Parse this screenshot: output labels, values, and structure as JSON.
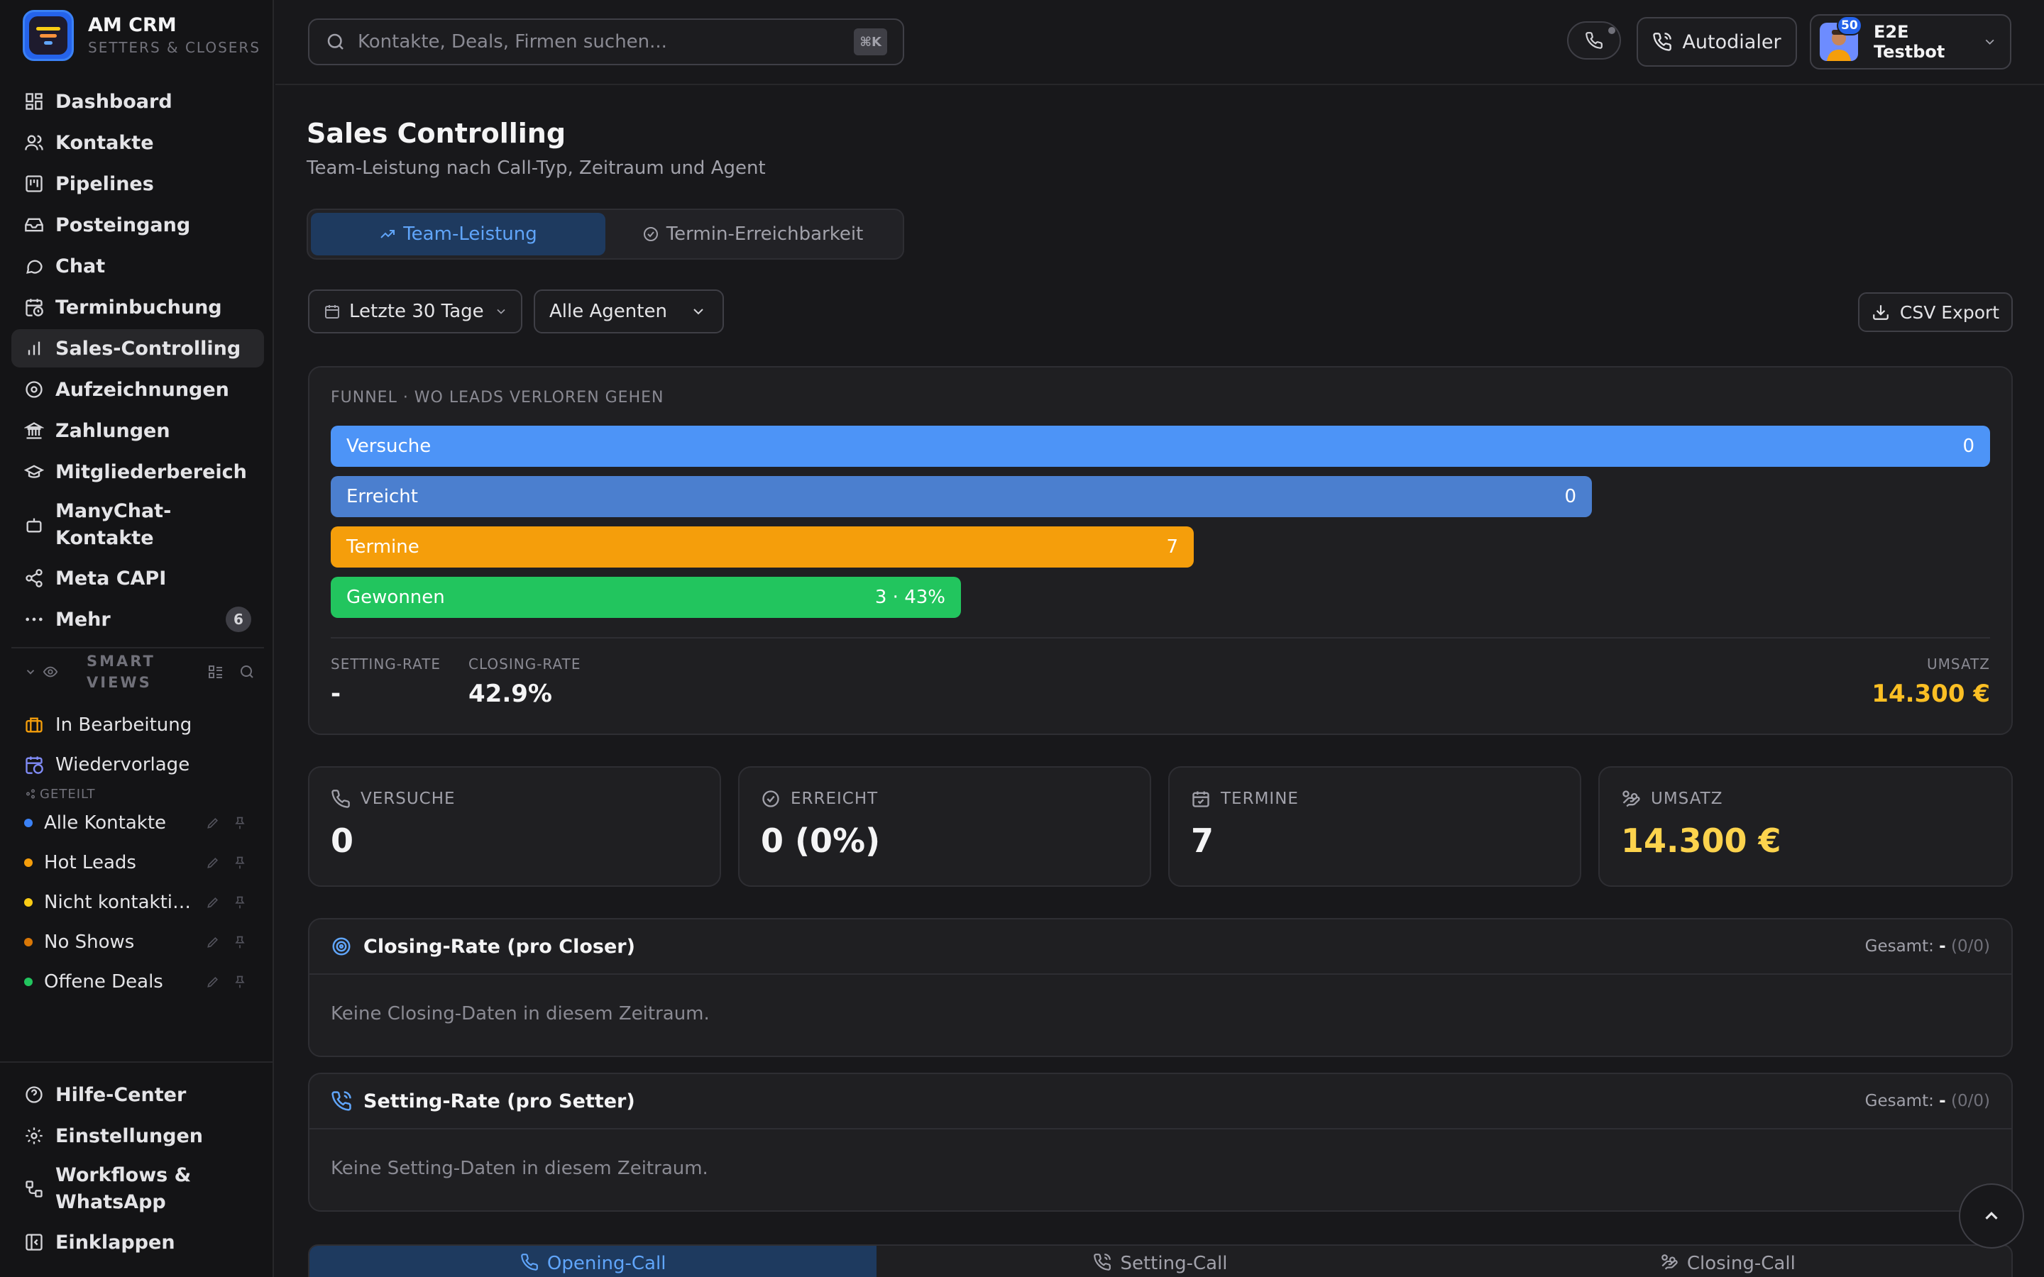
{
  "brand": {
    "title": "AM CRM",
    "subtitle": "SETTERS & CLOSERS"
  },
  "nav": [
    {
      "label": "Dashboard",
      "icon": "dashboard-icon"
    },
    {
      "label": "Kontakte",
      "icon": "users-icon"
    },
    {
      "label": "Pipelines",
      "icon": "kanban-icon"
    },
    {
      "label": "Posteingang",
      "icon": "inbox-icon"
    },
    {
      "label": "Chat",
      "icon": "chat-icon"
    },
    {
      "label": "Terminbuchung",
      "icon": "calendar-clock-icon"
    },
    {
      "label": "Sales-Controlling",
      "icon": "bar-chart-icon",
      "active": true
    },
    {
      "label": "Aufzeichnungen",
      "icon": "disc-icon"
    },
    {
      "label": "Zahlungen",
      "icon": "bank-icon"
    },
    {
      "label": "Mitgliederbereich",
      "icon": "graduation-cap-icon"
    },
    {
      "label": "ManyChat-Kontakte",
      "icon": "bot-icon"
    },
    {
      "label": "Meta CAPI",
      "icon": "share-icon"
    },
    {
      "label": "Mehr",
      "icon": "more-icon",
      "badge": "6"
    }
  ],
  "smart_views": {
    "title": "SMART VIEWS",
    "items": [
      {
        "label": "In Bearbeitung",
        "icon": "briefcase-icon",
        "color": "#f59e0b"
      },
      {
        "label": "Wiedervorlage",
        "icon": "calendar-clock-icon",
        "color": "#818cf8"
      }
    ],
    "shared_label": "GETEILT",
    "shared": [
      {
        "label": "Alle Kontakte",
        "color": "#3b82f6"
      },
      {
        "label": "Hot Leads",
        "color": "#f59e0b"
      },
      {
        "label": "Nicht kontaktiert",
        "color": "#facc15"
      },
      {
        "label": "No Shows",
        "color": "#d97706"
      },
      {
        "label": "Offene Deals",
        "color": "#22c55e"
      }
    ]
  },
  "bottom_nav": [
    {
      "label": "Hilfe-Center"
    },
    {
      "label": "Einstellungen"
    },
    {
      "label": "Workflows & WhatsApp"
    },
    {
      "label": "Einklappen"
    }
  ],
  "topbar": {
    "search_placeholder": "Kontakte, Deals, Firmen suchen...",
    "search_shortcut": "⌘K",
    "autodialer": "Autodialer",
    "user_name": "E2E Testbot",
    "user_level": "50"
  },
  "page": {
    "title": "Sales Controlling",
    "subtitle": "Team-Leistung nach Call-Typ, Zeitraum und Agent",
    "tabs": [
      "Team-Leistung",
      "Termin-Erreichbarkeit"
    ],
    "filter_period": "Letzte 30 Tage",
    "filter_agent": "Alle Agenten",
    "csv": "CSV Export"
  },
  "funnel": {
    "heading": "FUNNEL · WO LEADS VERLOREN GEHEN",
    "bars": [
      {
        "label": "Versuche",
        "value": "0",
        "fraction": 1.0,
        "color": "#4d94f7"
      },
      {
        "label": "Erreicht",
        "value": "0",
        "fraction": 0.76,
        "color": "#4b7fcf"
      },
      {
        "label": "Termine",
        "value": "7",
        "fraction": 0.52,
        "color": "#f59e0b"
      },
      {
        "label": "Gewonnen",
        "value": "3 · 43%",
        "fraction": 0.38,
        "color": "#22c55e"
      }
    ],
    "setting_rate_label": "SETTING-RATE",
    "setting_rate": "-",
    "closing_rate_label": "CLOSING-RATE",
    "closing_rate": "42.9%",
    "umsatz_label": "UMSATZ",
    "umsatz": "14.300 €"
  },
  "stats": [
    {
      "label": "VERSUCHE",
      "value": "0"
    },
    {
      "label": "ERREICHT",
      "value": "0 (0%)"
    },
    {
      "label": "TERMINE",
      "value": "7"
    },
    {
      "label": "UMSATZ",
      "value": "14.300 €"
    }
  ],
  "closing": {
    "title": "Closing-Rate (pro Closer)",
    "total_label": "Gesamt:",
    "total_value": "-",
    "total_count": "(0/0)",
    "empty": "Keine Closing-Daten in diesem Zeitraum."
  },
  "setting": {
    "title": "Setting-Rate (pro Setter)",
    "total_label": "Gesamt:",
    "total_value": "-",
    "total_count": "(0/0)",
    "empty": "Keine Setting-Daten in diesem Zeitraum."
  },
  "call_tabs": [
    "Opening-Call",
    "Setting-Call",
    "Closing-Call"
  ]
}
